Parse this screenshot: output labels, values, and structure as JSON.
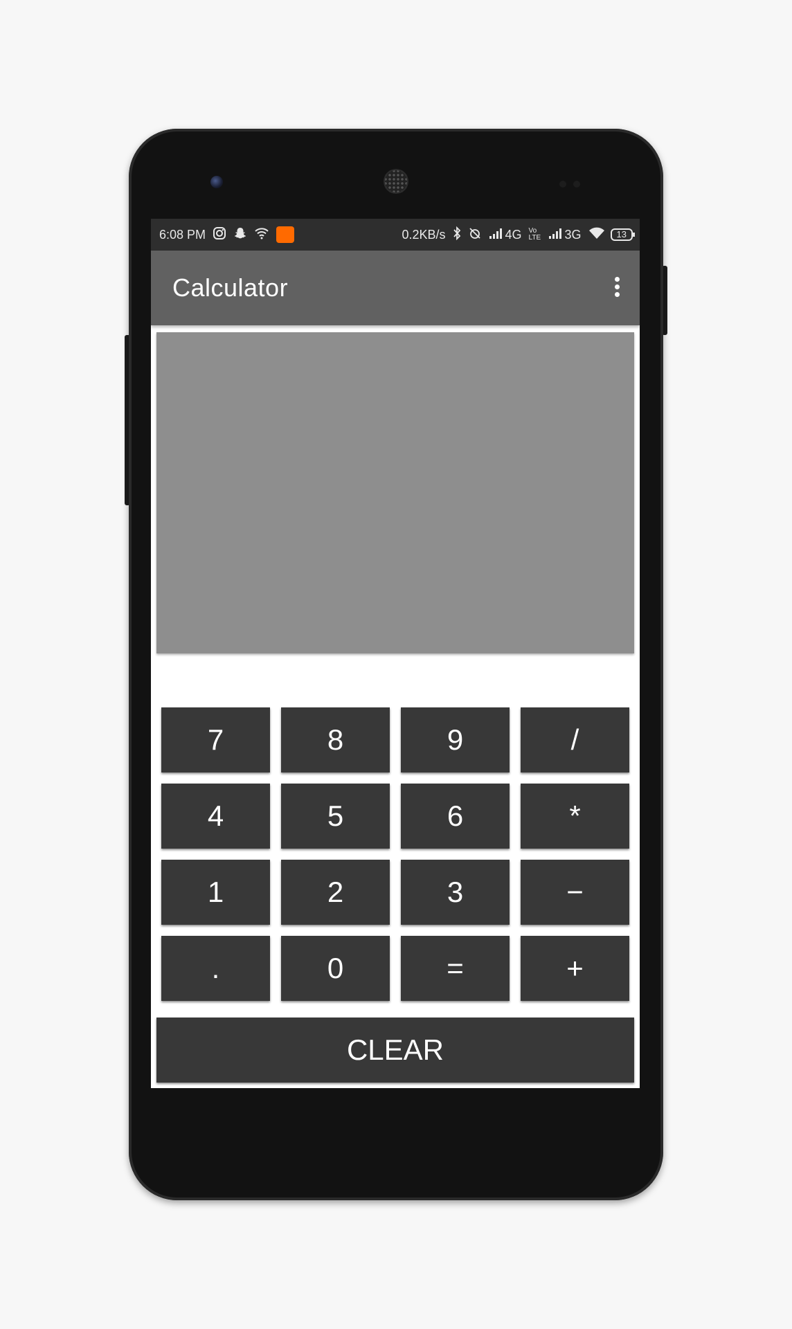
{
  "status_bar": {
    "time": "6:08 PM",
    "network_speed": "0.2KB/s",
    "signal_1_type": "4G",
    "volte": "Vo LTE",
    "signal_2_type": "3G",
    "battery": "13",
    "icons_left": [
      "instagram-icon",
      "snapchat-icon",
      "wifi-hotspot-icon",
      "app-notification-icon"
    ],
    "icons_right": [
      "bluetooth-icon",
      "alarm-off-icon",
      "signal-icon",
      "signal-icon",
      "wifi-icon",
      "battery-icon"
    ]
  },
  "app_bar": {
    "title": "Calculator",
    "menu_icon": "overflow-menu-icon"
  },
  "display": {
    "value": ""
  },
  "keypad": {
    "rows": [
      [
        "7",
        "8",
        "9",
        "/"
      ],
      [
        "4",
        "5",
        "6",
        "*"
      ],
      [
        "1",
        "2",
        "3",
        "−"
      ],
      [
        ".",
        "0",
        "=",
        "+"
      ]
    ]
  },
  "clear_label": "CLEAR",
  "colors": {
    "status_bar": "#2e2e2e",
    "app_bar": "#616161",
    "display": "#8e8e8e",
    "key": "#383838",
    "notification_orange": "#ff6a00"
  }
}
